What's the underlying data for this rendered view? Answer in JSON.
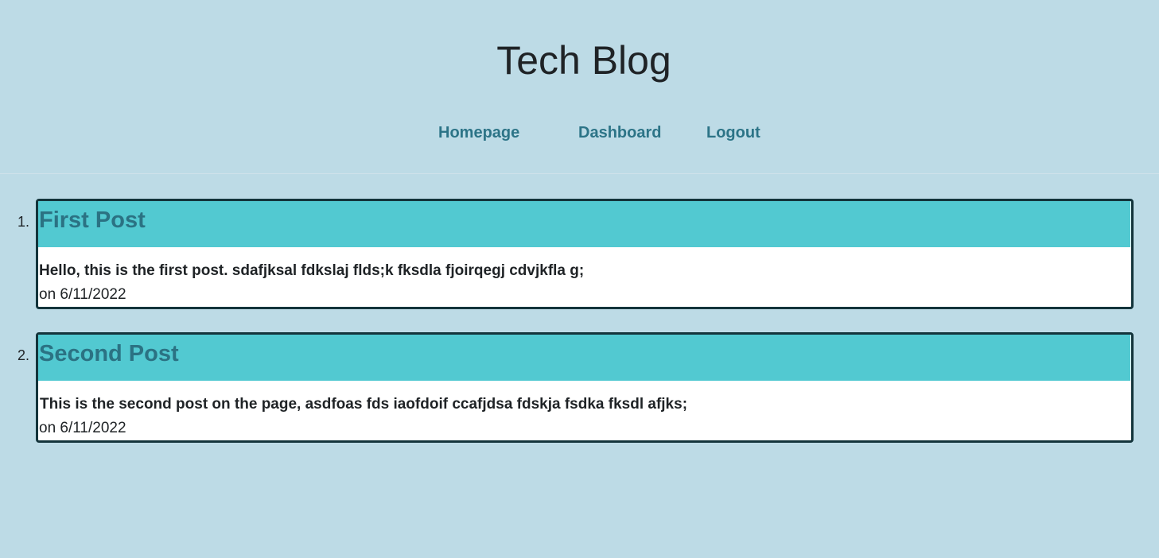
{
  "header": {
    "title": "Tech Blog",
    "nav": {
      "homepage": "Homepage",
      "dashboard": "Dashboard",
      "logout": "Logout"
    }
  },
  "posts": [
    {
      "number": "1.",
      "title": "First Post",
      "content": "Hello, this is the first post. sdafjksal fdkslaj flds;k fksdla fjoirqegj cdvjkfla g;",
      "date": "on 6/11/2022"
    },
    {
      "number": "2.",
      "title": "Second Post",
      "content": "This is the second post on the page, asdfoas fds iaofdoif ccafjdsa fdskja fsdka fksdl afjks;",
      "date": "on 6/11/2022"
    }
  ],
  "colors": {
    "background": "#bddbe6",
    "accent": "#52c9d1",
    "link": "#2c7487",
    "card_border": "#13343b"
  }
}
